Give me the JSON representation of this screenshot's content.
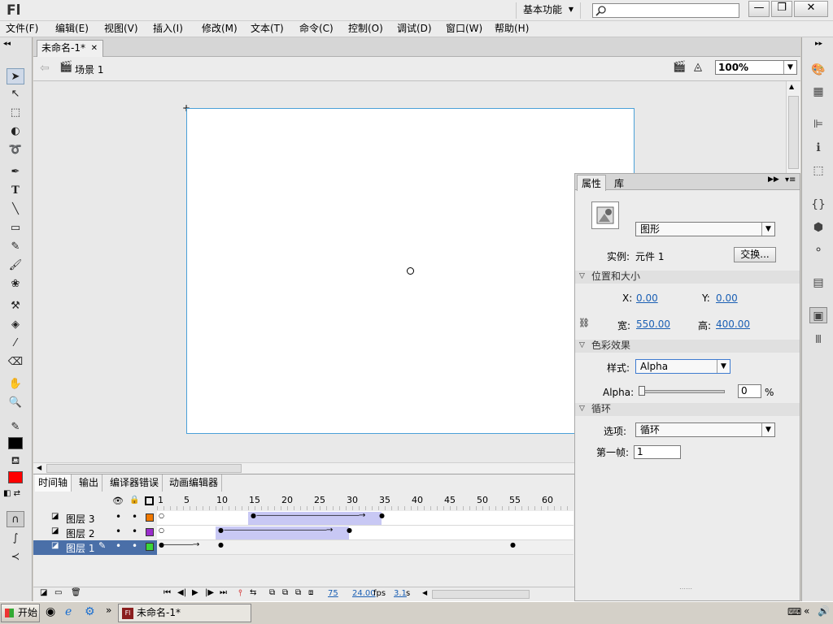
{
  "app": {
    "logo": "Fl",
    "workspace": "基本功能",
    "search_placeholder": ""
  },
  "menu": [
    "文件(F)",
    "编辑(E)",
    "视图(V)",
    "插入(I)",
    "修改(M)",
    "文本(T)",
    "命令(C)",
    "控制(O)",
    "调试(D)",
    "窗口(W)",
    "帮助(H)"
  ],
  "document": {
    "tab": "未命名-1*",
    "scene": "场景 1",
    "zoom": "100%"
  },
  "colors": {
    "stroke": "#000000",
    "fill": "#ff0000",
    "stage_border": "#4aa0d8",
    "tween_span": "#c8c8f4"
  },
  "timeline": {
    "tabs": [
      "时间轴",
      "输出",
      "编译器错误",
      "动画编辑器"
    ],
    "frame_numbers": [
      "1",
      "5",
      "10",
      "15",
      "20",
      "25",
      "30",
      "35",
      "40",
      "45",
      "50",
      "55",
      "60"
    ],
    "layers": [
      {
        "name": "图层 3",
        "color": "#f07800"
      },
      {
        "name": "图层 2",
        "color": "#9a2ccc"
      },
      {
        "name": "图层 1",
        "color": "#3ad838"
      }
    ],
    "current_frame": "75",
    "fps": "24.00",
    "fps_unit": "fps",
    "elapsed": "3.1",
    "elapsed_unit": "s"
  },
  "properties": {
    "tabs": [
      "属性",
      "库"
    ],
    "symbol_type": "图形",
    "instance_label": "实例:",
    "instance_value": "元件 1",
    "swap_button": "交换...",
    "pos_size_header": "位置和大小",
    "x_label": "X:",
    "x_value": "0.00",
    "y_label": "Y:",
    "y_value": "0.00",
    "w_label": "宽:",
    "w_value": "550.00",
    "h_label": "高:",
    "h_value": "400.00",
    "color_effect_header": "色彩效果",
    "style_label": "样式:",
    "style_value": "Alpha",
    "alpha_label": "Alpha:",
    "alpha_value": "0",
    "alpha_unit": "%",
    "loop_header": "循环",
    "option_label": "选项:",
    "option_value": "循环",
    "first_frame_label": "第一帧:",
    "first_frame_value": "1"
  },
  "taskbar": {
    "start": "开始",
    "task_item": "未命名-1*"
  }
}
